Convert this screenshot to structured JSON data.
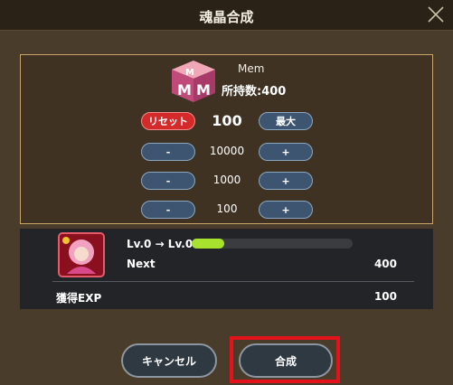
{
  "header": {
    "title": "魂晶合成"
  },
  "item": {
    "name": "Mem",
    "count_label": "所持数:400",
    "icon": "mem-cube-icon"
  },
  "controls": {
    "reset_label": "リセット",
    "current_value": "100",
    "max_label": "最大",
    "rows": [
      {
        "minus": "-",
        "value": "10000",
        "plus": "+"
      },
      {
        "minus": "-",
        "value": "1000",
        "plus": "+"
      },
      {
        "minus": "-",
        "value": "100",
        "plus": "+"
      }
    ]
  },
  "exp": {
    "level_text": "Lv.0 → Lv.0",
    "progress": 0.2,
    "next_label": "Next",
    "next_value": "400",
    "gain_label": "獲得EXP",
    "gain_value": "100"
  },
  "footer": {
    "cancel_label": "キャンセル",
    "confirm_label": "合成"
  },
  "colors": {
    "accent": "#a6e22e",
    "reset": "#d42a2a",
    "highlight": "#e3121b"
  }
}
